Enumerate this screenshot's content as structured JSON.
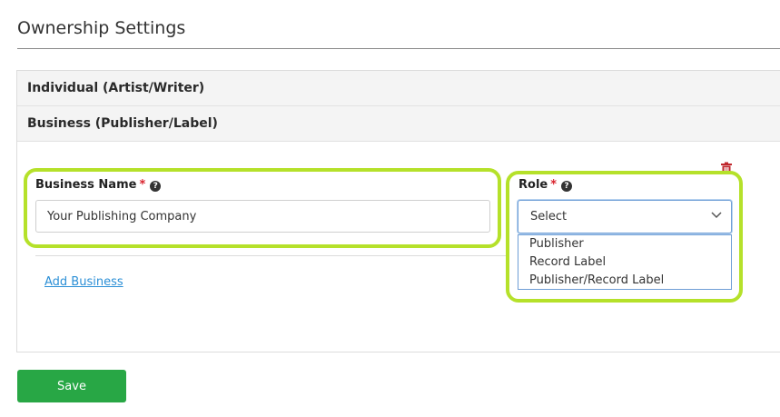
{
  "page": {
    "title": "Ownership Settings"
  },
  "accordion": {
    "individual_label": "Individual (Artist/Writer)",
    "business_label": "Business (Publisher/Label)"
  },
  "business_form": {
    "business_name_label": "Business Name",
    "business_name_required": "*",
    "business_name_value": "Your Publishing Company",
    "role_label": "Role",
    "role_required": "*",
    "role_selected": "Select",
    "role_options": [
      "Publisher",
      "Record Label",
      "Publisher/Record Label"
    ],
    "add_business_label": "Add Business"
  },
  "actions": {
    "save_label": "Save"
  },
  "icons": {
    "help": "question-circle-icon",
    "delete": "trash-icon",
    "dropdown": "chevron-down-icon"
  },
  "colors": {
    "primary_button": "#28a745",
    "link": "#2b8fd6",
    "required": "#d9232d",
    "highlight": "#b5e12a",
    "delete_icon": "#c0272d"
  }
}
